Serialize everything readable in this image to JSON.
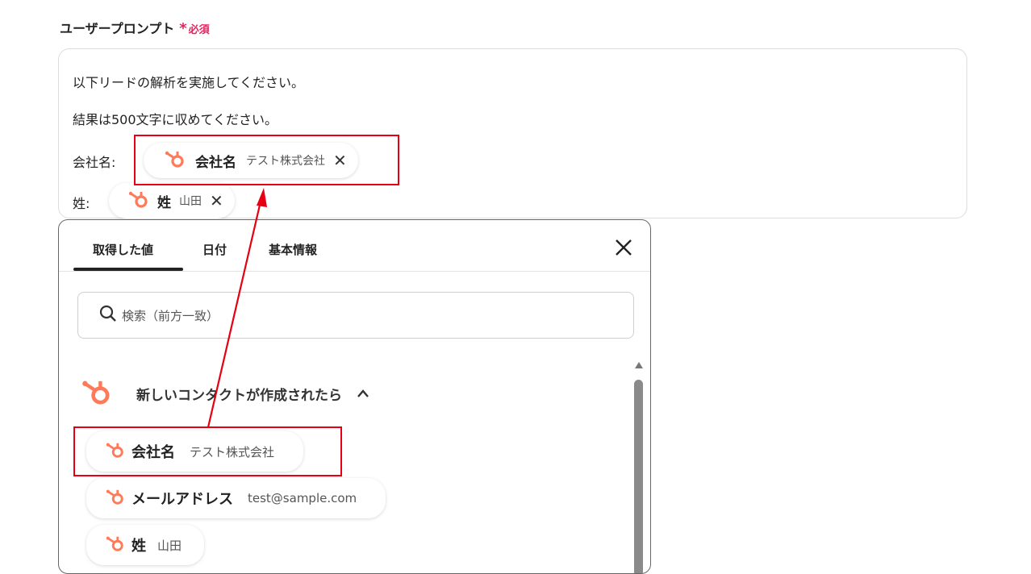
{
  "field": {
    "label": "ユーザープロンプト",
    "required_star": "*",
    "required_text": "必須"
  },
  "prompt": {
    "line1": "以下リードの解析を実施してください。",
    "line2": "結果は500文字に収めてください。",
    "company_label": "会社名:",
    "lastname_label": "姓:",
    "company_chip": {
      "name": "会社名",
      "value": "テスト株式会社"
    },
    "lastname_chip": {
      "name": "姓",
      "value": "山田"
    }
  },
  "panel": {
    "tabs": [
      {
        "label": "取得した値"
      },
      {
        "label": "日付"
      },
      {
        "label": "基本情報"
      }
    ],
    "search_placeholder": "検索（前方一致）",
    "group_title": "新しいコンタクトが作成されたら",
    "items": [
      {
        "name": "会社名",
        "value": "テスト株式会社"
      },
      {
        "name": "メールアドレス",
        "value": "test@sample.com"
      },
      {
        "name": "姓",
        "value": "山田"
      }
    ]
  },
  "colors": {
    "hubspot": "#ff7a59",
    "required": "#e0245e",
    "highlight": "#e60012"
  },
  "icons": {
    "brand": "hubspot-icon",
    "remove": "close-icon",
    "search": "search-icon",
    "collapse": "chevron-up-icon"
  }
}
